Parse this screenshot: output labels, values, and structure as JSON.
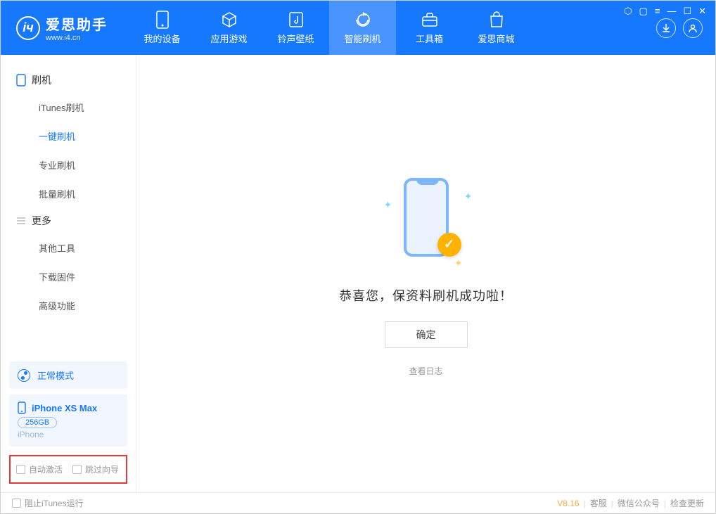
{
  "header": {
    "app_name": "爱思助手",
    "url": "www.i4.cn",
    "tabs": [
      {
        "label": "我的设备",
        "icon": "device-icon"
      },
      {
        "label": "应用游戏",
        "icon": "cube-icon"
      },
      {
        "label": "铃声壁纸",
        "icon": "music-icon"
      },
      {
        "label": "智能刷机",
        "icon": "refresh-icon",
        "active": true
      },
      {
        "label": "工具箱",
        "icon": "toolbox-icon"
      },
      {
        "label": "爱思商城",
        "icon": "bag-icon"
      }
    ],
    "download_icon": "download-icon",
    "user_icon": "user-icon",
    "window_controls": {
      "shirt": "⬡",
      "scan": "▢",
      "menu": "≡",
      "min": "—",
      "max": "☐",
      "close": "✕"
    }
  },
  "sidebar": {
    "group_flash": {
      "icon": "phone-icon",
      "label": "刷机"
    },
    "flash_items": [
      {
        "label": "iTunes刷机"
      },
      {
        "label": "一键刷机",
        "active": true
      },
      {
        "label": "专业刷机"
      },
      {
        "label": "批量刷机"
      }
    ],
    "group_more": {
      "icon": "list-icon",
      "label": "更多"
    },
    "more_items": [
      {
        "label": "其他工具"
      },
      {
        "label": "下载固件"
      },
      {
        "label": "高级功能"
      }
    ],
    "mode": {
      "label": "正常模式"
    },
    "device": {
      "name": "iPhone XS Max",
      "storage": "256GB",
      "type": "iPhone"
    },
    "checks": {
      "auto_activate": "自动激活",
      "skip_wizard": "跳过向导"
    }
  },
  "main": {
    "success_msg": "恭喜您，保资料刷机成功啦！",
    "ok_button": "确定",
    "view_log": "查看日志"
  },
  "footer": {
    "block_itunes": "阻止iTunes运行",
    "version": "V8.16",
    "support": "客服",
    "wechat": "微信公众号",
    "check_update": "检查更新"
  }
}
